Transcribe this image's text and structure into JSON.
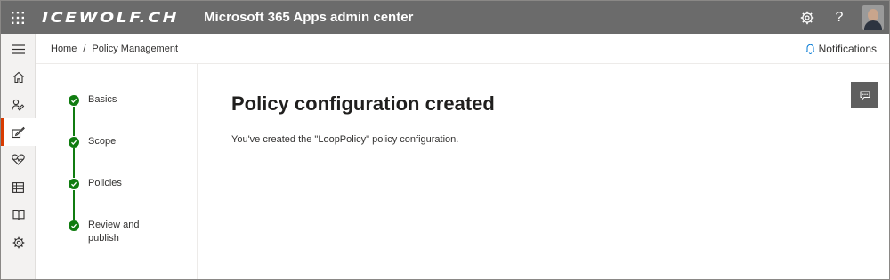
{
  "header": {
    "brand": "ICEWOLF.CH",
    "app_title": "Microsoft 365 Apps admin center",
    "icons": [
      "waffle-icon",
      "gear-icon",
      "help-icon",
      "avatar"
    ],
    "help_label": "?",
    "bar_color": "#6b6b6b"
  },
  "nav": {
    "items": [
      {
        "name": "collapse-menu",
        "icon": "hamburger-icon"
      },
      {
        "name": "home",
        "icon": "home-icon"
      },
      {
        "name": "users",
        "icon": "people-icon"
      },
      {
        "name": "policy-management",
        "icon": "policy-icon",
        "active": true
      },
      {
        "name": "health",
        "icon": "health-icon"
      },
      {
        "name": "inventory",
        "icon": "grid-icon"
      },
      {
        "name": "learn",
        "icon": "book-icon"
      },
      {
        "name": "settings",
        "icon": "gear-icon"
      }
    ],
    "active_accent": "#d83b01"
  },
  "breadcrumb": {
    "home": "Home",
    "separator": "/",
    "current": "Policy Management"
  },
  "notifications": {
    "label": "Notifications"
  },
  "wizard": {
    "steps": [
      {
        "label": "Basics",
        "status": "completed"
      },
      {
        "label": "Scope",
        "status": "completed"
      },
      {
        "label": "Policies",
        "status": "completed"
      },
      {
        "label": "Review and publish",
        "status": "completed"
      }
    ],
    "completed_color": "#107c10"
  },
  "main": {
    "title": "Policy configuration created",
    "description": "You've created the \"LoopPolicy\" policy configuration."
  },
  "feedback": {
    "icon": "feedback-icon"
  }
}
